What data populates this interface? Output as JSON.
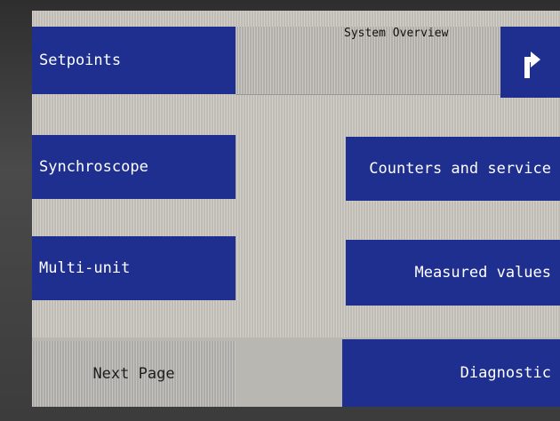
{
  "header": {
    "title": "System Overview",
    "up_icon": "arrow-up-right-icon"
  },
  "menu": {
    "setpoints": "Setpoints",
    "synchroscope": "Synchroscope",
    "multi_unit": "Multi-unit",
    "counters_and_service": "Counters and service",
    "measured_values": "Measured values",
    "next_page": "Next Page",
    "diagnostic": "Diagnostic"
  },
  "colors": {
    "button_blue": "#1f2f8f",
    "screen_bg": "#c9c6c0",
    "text_on_blue": "#ffffff"
  }
}
